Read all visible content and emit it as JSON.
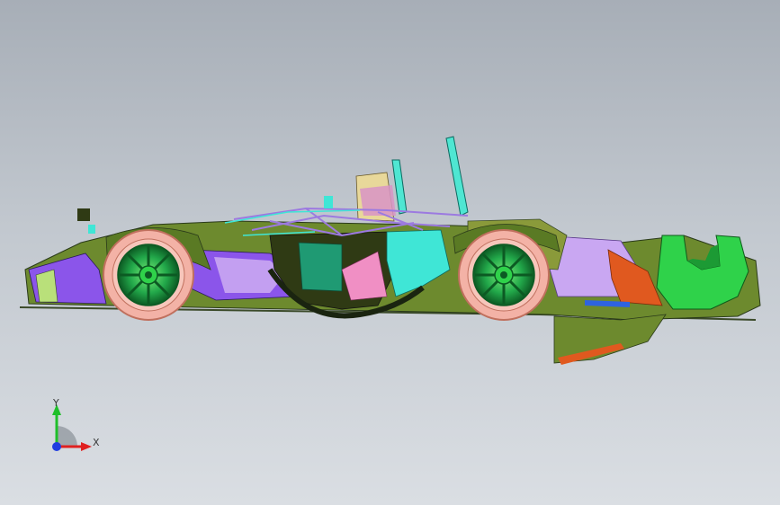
{
  "triad": {
    "x_label": "X",
    "y_label": "Y"
  },
  "model": {
    "colors": {
      "tire": "#f3b2a6",
      "rim": "#1fae4a",
      "body_green": "#6d8a2e",
      "body_purple": "#8b55ea",
      "body_lilac": "#c9a7f2",
      "body_cyan": "#3fe6d6",
      "body_teal": "#1f9a73",
      "wing_green": "#2fd24a",
      "orange": "#e0591f",
      "pink": "#f08fc4",
      "dark": "#2a3a1a",
      "blue": "#2e63e0"
    }
  }
}
